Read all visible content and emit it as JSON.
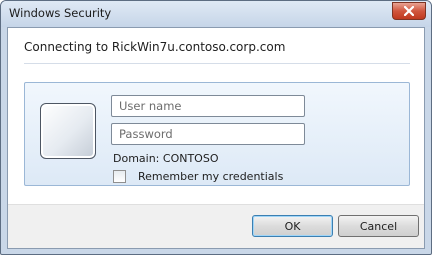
{
  "window": {
    "title": "Windows Security",
    "close_icon": "close-icon"
  },
  "dialog": {
    "connecting_text": "Connecting to RickWin7u.contoso.corp.com"
  },
  "credentials": {
    "user_tile_icon": "user-tile-icon",
    "username_placeholder": "User name",
    "username_value": "",
    "password_placeholder": "Password",
    "password_value": "",
    "domain_text": "Domain: CONTOSO",
    "remember_label": "Remember my credentials",
    "remember_checked": false
  },
  "buttons": {
    "ok_label": "OK",
    "cancel_label": "Cancel"
  },
  "colors": {
    "title_gradient_top": "#dfe9f5",
    "close_button": "#c0391f",
    "panel_border": "#9bb7d6",
    "default_button_border": "#3c7fb1"
  }
}
